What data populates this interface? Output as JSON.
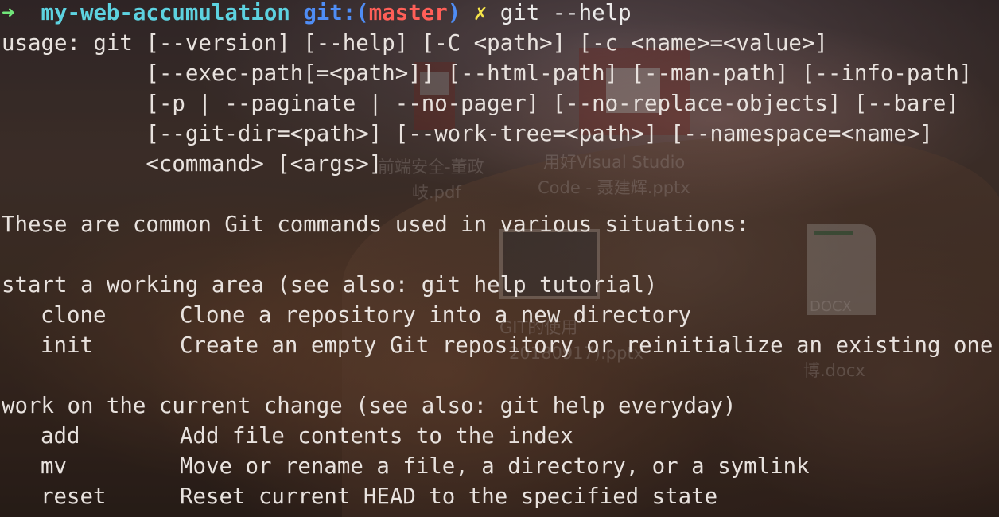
{
  "prompt": {
    "arrow": "➜",
    "directory": "my-web-accumulation",
    "git_label": "git:(",
    "branch": "master",
    "git_close": ")",
    "dirty_marker": "✗",
    "command": "git --help"
  },
  "usage_lines": [
    "usage: git [--version] [--help] [-C <path>] [-c <name>=<value>]",
    "           [--exec-path[=<path>]] [--html-path] [--man-path] [--info-path]",
    "           [-p | --paginate | --no-pager] [--no-replace-objects] [--bare]",
    "           [--git-dir=<path>] [--work-tree=<path>] [--namespace=<name>]",
    "           <command> [<args>]"
  ],
  "intro": "These are common Git commands used in various situations:",
  "sections": [
    {
      "heading": "start a working area (see also: git help tutorial)",
      "commands": [
        {
          "name": "clone",
          "description": "Clone a repository into a new directory"
        },
        {
          "name": "init",
          "description": "Create an empty Git repository or reinitialize an existing one"
        }
      ]
    },
    {
      "heading": "work on the current change (see also: git help everyday)",
      "commands": [
        {
          "name": "add",
          "description": "Add file contents to the index"
        },
        {
          "name": "mv",
          "description": "Move or rename a file, a directory, or a symlink"
        },
        {
          "name": "reset",
          "description": "Reset current HEAD to the specified state"
        }
      ]
    }
  ],
  "desktop_labels": {
    "pdf_line1": "前端安全-董政",
    "pdf_line2": "岐.pdf",
    "pptx_line1": "用好Visual Studio",
    "pptx_line2": "Code - 聂建辉.pptx",
    "git_line1": "GIT的使用",
    "git_line2": "20180917).pptx",
    "docx_badge": "DOCX",
    "docx_line": "博.docx"
  },
  "colors": {
    "prompt_arrow": "#71e67a",
    "directory": "#5dd2e0",
    "git_label": "#4f8df5",
    "branch": "#ff5f58",
    "dirty_marker": "#f5e44a",
    "text": "#e8e2de"
  }
}
